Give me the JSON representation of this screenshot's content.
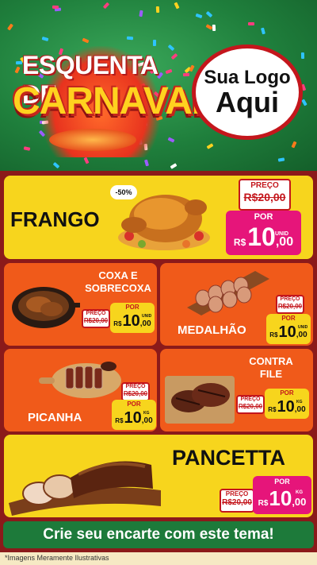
{
  "header": {
    "title_line1": "ESQUENTA DE",
    "title_line2": "CARNAVAL",
    "logo_line1": "Sua Logo",
    "logo_line2": "Aqui"
  },
  "products": {
    "frango": {
      "name": "FRANGO",
      "discount_badge": "-50%",
      "preco_label": "PREÇO",
      "old_price": "R$20,00",
      "por_label": "POR",
      "currency": "R$",
      "price_int": "10",
      "price_dec": ",00",
      "unit": "UNID"
    },
    "coxa": {
      "name_line1": "COXA E",
      "name_line2": "SOBRECOXA",
      "preco_label": "PREÇO",
      "old_price": "R$20,00",
      "por_label": "POR",
      "currency": "R$",
      "price_int": "10",
      "price_dec": ",00",
      "unit": "UNID"
    },
    "medalhao": {
      "name": "MEDALHÃO",
      "preco_label": "PREÇO",
      "old_price": "R$20,00",
      "por_label": "POR",
      "currency": "R$",
      "price_int": "10",
      "price_dec": ",00",
      "unit": "UNID"
    },
    "picanha": {
      "name": "PICANHA",
      "preco_label": "PREÇO",
      "old_price": "R$20,00",
      "por_label": "POR",
      "currency": "R$",
      "price_int": "10",
      "price_dec": ",00",
      "unit": "KG"
    },
    "contrafile": {
      "name_line1": "CONTRA",
      "name_line2": "FILE",
      "preco_label": "PREÇO",
      "old_price": "R$20,00",
      "por_label": "POR",
      "currency": "R$",
      "price_int": "10",
      "price_dec": ",00",
      "unit": "KG"
    },
    "pancetta": {
      "name": "PANCETTA",
      "preco_label": "PREÇO",
      "old_price": "R$20,00",
      "por_label": "POR",
      "currency": "R$",
      "price_int": "10",
      "price_dec": ",00",
      "unit": "KG"
    }
  },
  "footer": {
    "cta": "Crie seu encarte com este tema!",
    "disclaimer": "*Imagens Meramente Ilustrativas"
  },
  "colors": {
    "header_green": "#1f7f3c",
    "card_yellow": "#f7d51d",
    "card_orange": "#f05a1a",
    "price_magenta": "#e6157a",
    "price_red": "#c4161c",
    "frame_dark_red": "#8b1a1a",
    "cta_green": "#1d7a3a"
  }
}
